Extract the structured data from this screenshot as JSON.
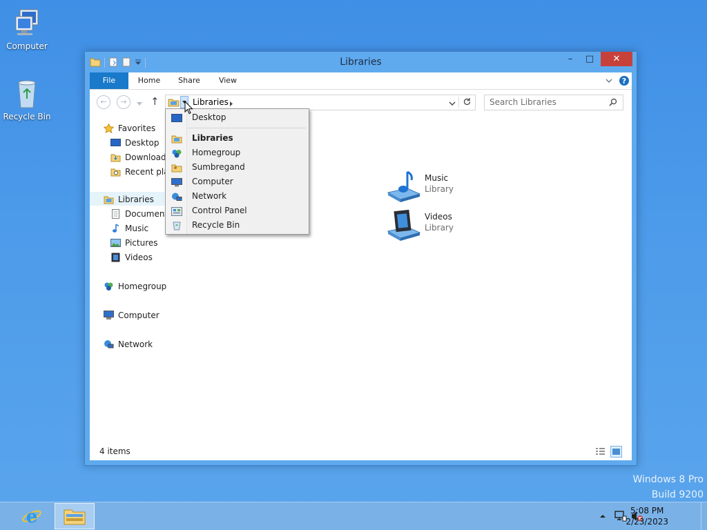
{
  "desktop": {
    "icons": [
      {
        "label": "Computer",
        "icon": "computer-icon"
      },
      {
        "label": "Recycle Bin",
        "icon": "recycle-bin-icon"
      }
    ],
    "watermark": {
      "line1": "Windows 8 Pro",
      "line2": "Build 9200"
    }
  },
  "window": {
    "title": "Libraries",
    "controls": {
      "minimize": "–",
      "maximize": "□",
      "close": "✕"
    },
    "ribbon_tabs": [
      "File",
      "Home",
      "Share",
      "View"
    ],
    "address": {
      "crumb": "Libraries"
    },
    "search": {
      "placeholder": "Search Libraries"
    },
    "nav": {
      "favorites": {
        "label": "Favorites",
        "items": [
          "Desktop",
          "Downloads",
          "Recent places"
        ]
      },
      "libraries": {
        "label": "Libraries",
        "items": [
          "Documents",
          "Music",
          "Pictures",
          "Videos"
        ]
      },
      "homegroup": "Homegroup",
      "computer": "Computer",
      "network": "Network"
    },
    "libraries": [
      {
        "name": "Music",
        "type": "Library",
        "icon": "music-library-icon"
      },
      {
        "name": "Videos",
        "type": "Library",
        "icon": "videos-library-icon"
      }
    ],
    "status": "4 items"
  },
  "address_dropdown": {
    "items": [
      {
        "label": "Desktop",
        "icon": "desktop-icon",
        "bold": false
      },
      {
        "label": "Libraries",
        "icon": "libraries-icon",
        "bold": true
      },
      {
        "label": "Homegroup",
        "icon": "homegroup-icon",
        "bold": false
      },
      {
        "label": "Sumbregand",
        "icon": "user-folder-icon",
        "bold": false
      },
      {
        "label": "Computer",
        "icon": "computer-icon",
        "bold": false
      },
      {
        "label": "Network",
        "icon": "network-icon",
        "bold": false
      },
      {
        "label": "Control Panel",
        "icon": "control-panel-icon",
        "bold": false
      },
      {
        "label": "Recycle Bin",
        "icon": "recycle-bin-icon",
        "bold": false
      }
    ]
  },
  "taskbar": {
    "clock": {
      "time": "5:08 PM",
      "date": "2/23/2023"
    },
    "tray_icons": [
      "show-hidden-icons-icon",
      "network-status-icon",
      "volume-muted-icon"
    ]
  },
  "colors": {
    "file_tab": "#1979ca",
    "close_button": "#c7413b",
    "window_frame": "#5fa9ee"
  }
}
